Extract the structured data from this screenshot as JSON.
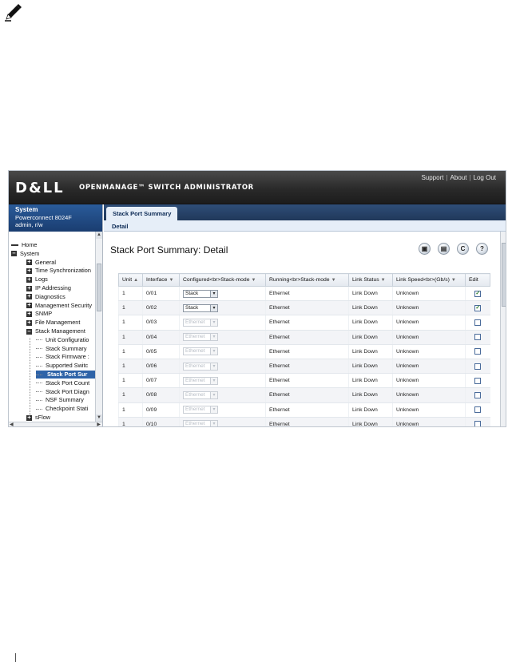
{
  "banner": {
    "logo": "D&LL",
    "product": "OPENMANAGE™ SWITCH ADMINISTRATOR",
    "links": [
      "Support",
      "About",
      "Log Out"
    ]
  },
  "sidebar": {
    "header": {
      "title": "System",
      "model": "Powerconnect 8024F",
      "user": "admin, r/w"
    },
    "tree": [
      {
        "label": "Home",
        "level": 0,
        "kind": "leaf"
      },
      {
        "label": "System",
        "level": 0,
        "kind": "expanded"
      },
      {
        "label": "General",
        "level": 1,
        "kind": "collapsed"
      },
      {
        "label": "Time Synchronization",
        "level": 1,
        "kind": "collapsed"
      },
      {
        "label": "Logs",
        "level": 1,
        "kind": "collapsed"
      },
      {
        "label": "IP Addressing",
        "level": 1,
        "kind": "collapsed"
      },
      {
        "label": "Diagnostics",
        "level": 1,
        "kind": "collapsed"
      },
      {
        "label": "Management Security",
        "level": 1,
        "kind": "collapsed"
      },
      {
        "label": "SNMP",
        "level": 1,
        "kind": "collapsed"
      },
      {
        "label": "File Management",
        "level": 1,
        "kind": "collapsed"
      },
      {
        "label": "Stack Management",
        "level": 1,
        "kind": "expanded"
      },
      {
        "label": "Unit Configuratio",
        "level": 2,
        "kind": "leaf"
      },
      {
        "label": "Stack Summary",
        "level": 2,
        "kind": "leaf"
      },
      {
        "label": "Stack Firmware :",
        "level": 2,
        "kind": "leaf"
      },
      {
        "label": "Supported Switc",
        "level": 2,
        "kind": "leaf"
      },
      {
        "label": "Stack Port Sur",
        "level": 2,
        "kind": "selected"
      },
      {
        "label": "Stack Port Count",
        "level": 2,
        "kind": "leaf"
      },
      {
        "label": "Stack Port Diagn",
        "level": 2,
        "kind": "leaf"
      },
      {
        "label": "NSF Summary",
        "level": 2,
        "kind": "leaf"
      },
      {
        "label": "Checkpoint Stati",
        "level": 2,
        "kind": "leaf"
      },
      {
        "label": "sFlow",
        "level": 1,
        "kind": "collapsed"
      }
    ]
  },
  "main": {
    "tab": "Stack Port Summary",
    "subtab": "Detail",
    "title": "Stack Port Summary: Detail",
    "actions": [
      {
        "name": "save-icon",
        "glyph": "▣"
      },
      {
        "name": "print-icon",
        "glyph": "▤"
      },
      {
        "name": "refresh-icon",
        "glyph": "C"
      },
      {
        "name": "help-icon",
        "glyph": "?"
      }
    ],
    "table": {
      "columns": [
        "Unit",
        "Interface",
        "Configured<br>Stack-mode",
        "Running<br>Stack-mode",
        "Link Status",
        "Link Speed<br>(Gb/s)",
        "Edit"
      ],
      "sort_indicator": "▲",
      "filter_indicator": "▼",
      "rows": [
        {
          "unit": "1",
          "interface": "0/01",
          "configured": "Stack",
          "enabled": true,
          "running": "Ethernet",
          "status": "Link Down",
          "speed": "Unknown",
          "edit": true
        },
        {
          "unit": "1",
          "interface": "0/02",
          "configured": "Stack",
          "enabled": true,
          "running": "Ethernet",
          "status": "Link Down",
          "speed": "Unknown",
          "edit": true
        },
        {
          "unit": "1",
          "interface": "0/03",
          "configured": "Ethernet",
          "enabled": false,
          "running": "Ethernet",
          "status": "Link Down",
          "speed": "Unknown",
          "edit": false
        },
        {
          "unit": "1",
          "interface": "0/04",
          "configured": "Ethernet",
          "enabled": false,
          "running": "Ethernet",
          "status": "Link Down",
          "speed": "Unknown",
          "edit": false
        },
        {
          "unit": "1",
          "interface": "0/05",
          "configured": "Ethernet",
          "enabled": false,
          "running": "Ethernet",
          "status": "Link Down",
          "speed": "Unknown",
          "edit": false
        },
        {
          "unit": "1",
          "interface": "0/06",
          "configured": "Ethernet",
          "enabled": false,
          "running": "Ethernet",
          "status": "Link Down",
          "speed": "Unknown",
          "edit": false
        },
        {
          "unit": "1",
          "interface": "0/07",
          "configured": "Ethernet",
          "enabled": false,
          "running": "Ethernet",
          "status": "Link Down",
          "speed": "Unknown",
          "edit": false
        },
        {
          "unit": "1",
          "interface": "0/08",
          "configured": "Ethernet",
          "enabled": false,
          "running": "Ethernet",
          "status": "Link Down",
          "speed": "Unknown",
          "edit": false
        },
        {
          "unit": "1",
          "interface": "0/09",
          "configured": "Ethernet",
          "enabled": false,
          "running": "Ethernet",
          "status": "Link Down",
          "speed": "Unknown",
          "edit": false
        },
        {
          "unit": "1",
          "interface": "0/10",
          "configured": "Ethernet",
          "enabled": false,
          "running": "Ethernet",
          "status": "Link Down",
          "speed": "Unknown",
          "edit": false
        }
      ]
    }
  },
  "colors": {
    "banner": "#2a2a2a",
    "nav_header": "#1a3d70",
    "tab_bar": "#20385a",
    "selection": "#2e63a8",
    "check": "#2a7d2a"
  }
}
